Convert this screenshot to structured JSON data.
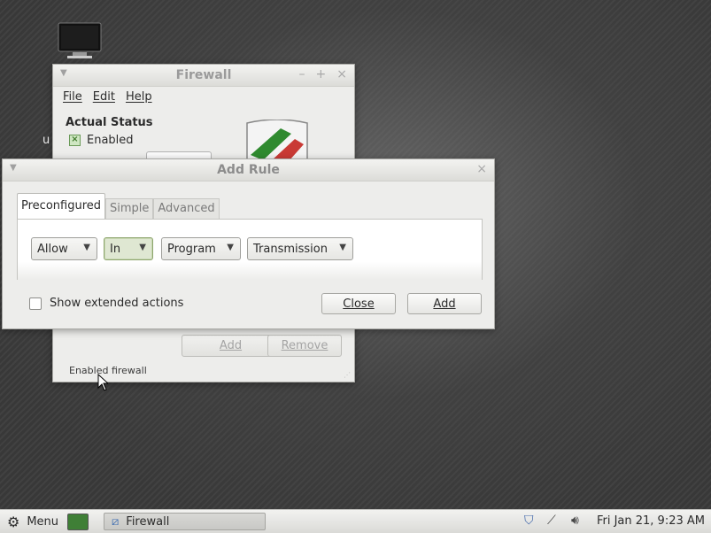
{
  "desktop": {
    "icon_name": "computer-icon",
    "partial_label": "u"
  },
  "firewall": {
    "title": "Firewall",
    "menu": {
      "file": "File",
      "edit": "Edit",
      "help": "Help"
    },
    "status_heading": "Actual Status",
    "enabled_label": "Enabled",
    "add_button": "Add",
    "remove_button": "Remove",
    "status_text": "Enabled firewall"
  },
  "add_rule": {
    "title": "Add Rule",
    "tabs": {
      "preconfigured": "Preconfigured",
      "simple": "Simple",
      "advanced": "Advanced"
    },
    "policy": "Allow",
    "direction": "In",
    "category": "Program",
    "application": "Transmission",
    "extended_label": "Show extended actions",
    "close_button": "Close",
    "add_button": "Add"
  },
  "taskbar": {
    "menu_label": "Menu",
    "task_label": "Firewall",
    "clock": "Fri Jan 21,  9:23 AM"
  }
}
